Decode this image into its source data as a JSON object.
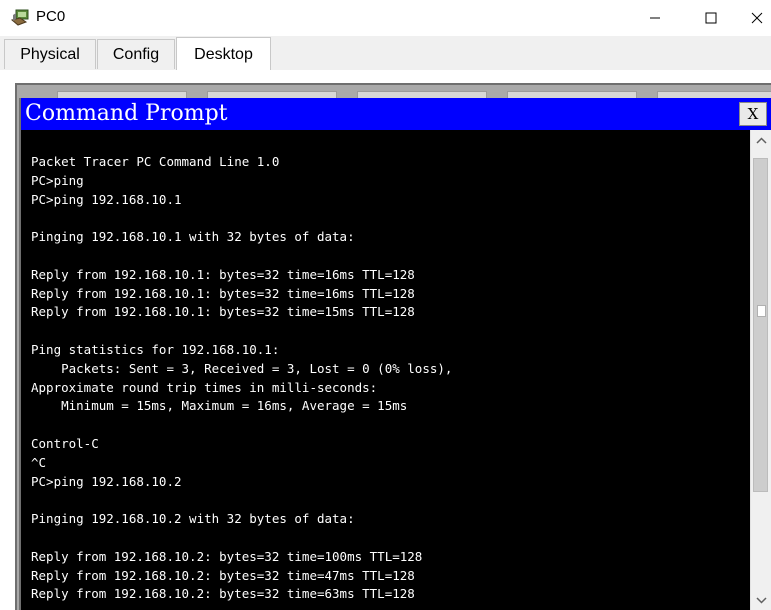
{
  "window": {
    "title": "PC0",
    "icon": "pc-icon",
    "controls": [
      "minimize-icon",
      "maximize-icon",
      "close-icon"
    ]
  },
  "tabs": [
    {
      "label": "Physical",
      "active": false
    },
    {
      "label": "Config",
      "active": false
    },
    {
      "label": "Desktop",
      "active": true
    }
  ],
  "command_prompt": {
    "title": "Command Prompt",
    "close_label": "X",
    "title_color": "#0000ff",
    "lines": [
      "Packet Tracer PC Command Line 1.0",
      "PC>ping",
      "PC>ping 192.168.10.1",
      "",
      "Pinging 192.168.10.1 with 32 bytes of data:",
      "",
      "Reply from 192.168.10.1: bytes=32 time=16ms TTL=128",
      "Reply from 192.168.10.1: bytes=32 time=16ms TTL=128",
      "Reply from 192.168.10.1: bytes=32 time=15ms TTL=128",
      "",
      "Ping statistics for 192.168.10.1:",
      "    Packets: Sent = 3, Received = 3, Lost = 0 (0% loss),",
      "Approximate round trip times in milli-seconds:",
      "    Minimum = 15ms, Maximum = 16ms, Average = 15ms",
      "",
      "Control-C",
      "^C",
      "PC>ping 192.168.10.2",
      "",
      "Pinging 192.168.10.2 with 32 bytes of data:",
      "",
      "Reply from 192.168.10.2: bytes=32 time=100ms TTL=128",
      "Reply from 192.168.10.2: bytes=32 time=47ms TTL=128",
      "Reply from 192.168.10.2: bytes=32 time=63ms TTL=128"
    ]
  },
  "scrollbar": {
    "icons": [
      "chevron-up-icon",
      "chevron-down-icon"
    ],
    "position_fraction": 0.0
  }
}
